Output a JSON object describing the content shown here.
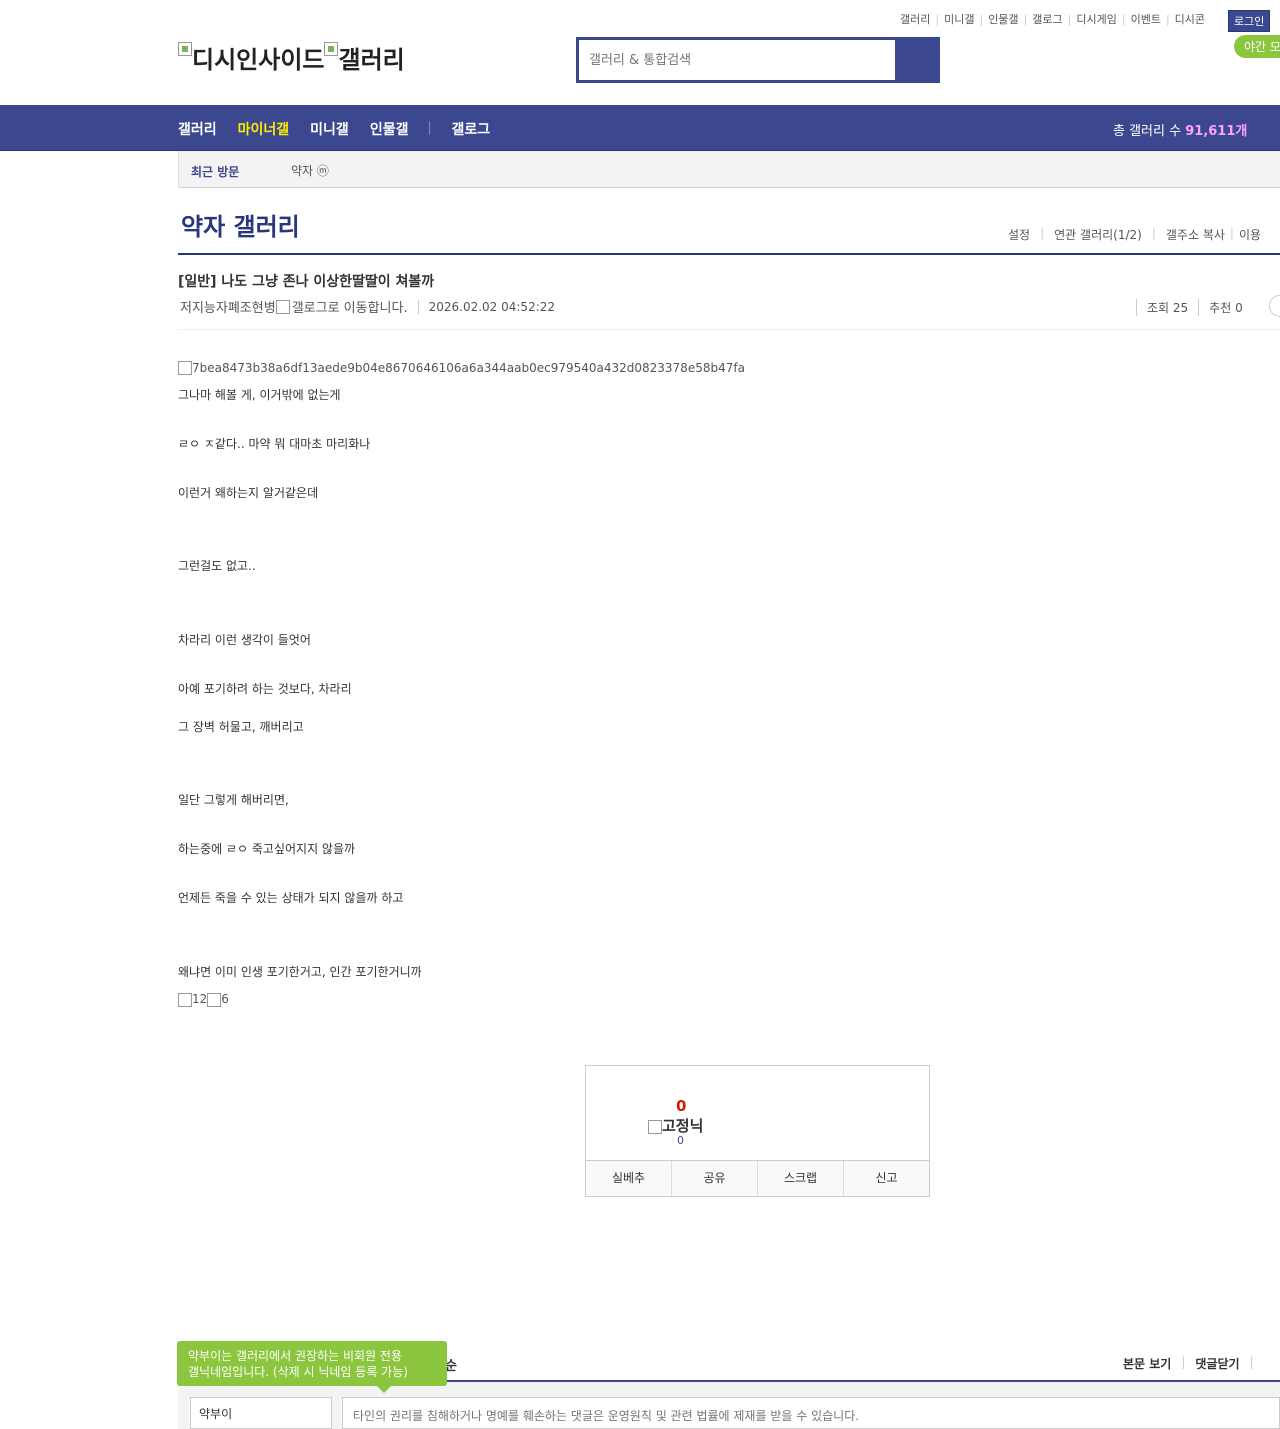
{
  "util_links": [
    "갤러리",
    "미니갤",
    "인물갤",
    "갤로그",
    "디시게임",
    "이벤트",
    "디시콘"
  ],
  "login_label": "로그인",
  "night_mode_label": "야간 모",
  "logo": {
    "left": "디시인사이드",
    "right": "갤러리"
  },
  "search": {
    "placeholder": "갤러리 & 통합검색"
  },
  "gnb": {
    "items": [
      "갤러리",
      "마이너갤",
      "미니갤",
      "인물갤"
    ],
    "gallog": "갤로그",
    "total_label": "총 갤러리 수",
    "total_count": "91,611개"
  },
  "recent": {
    "label": "최근 방문",
    "item": "약자 ⓜ"
  },
  "gallery": {
    "title": "약자 갤러리",
    "tools": [
      "설정",
      "연관 갤러리(1/2)",
      "갤주소 복사",
      "이용"
    ]
  },
  "post": {
    "title": "[일반] 나도 그냥 존나 이상한딸딸이 쳐볼까",
    "author": "저지능자폐조현병",
    "gallog_link": "갤로그로 이동합니다.",
    "date": "2026.02.02 04:52:22",
    "views": "조회 25",
    "recommend": "추천 0",
    "image_alt": "7bea8473b38a6df13aede9b04e8670646106a6a344aab0ec979540a432d0823378e58b47fa",
    "paragraphs": [
      "그나마 해볼 게, 이거밖에 없는게",
      "ㄹㅇ ㅈ같다.. 마약 뭐 대마초 마리화나",
      "이런거 왜하는지 알거같은데",
      "그런걸도 없고..",
      "차라리 이런 생각이 들엇어",
      "아예 포기하려 하는 것보다, 차라리",
      "그 장벽 허물고, 깨버리고",
      "일단 그렇게 해버리면,",
      "하는중에 ㄹㅇ 죽고싶어지지 않을까",
      "언제든 죽을 수 있는 상태가 되지 않을까 하고",
      "왜냐면 이미 인생 포기한거고, 인간 포기한거니까"
    ],
    "bottom_imgs": [
      "12",
      "6"
    ]
  },
  "recommend_box": {
    "count": "0",
    "fixed_nick_label": "고정닉",
    "fixed_count": "0",
    "buttons": [
      "실베추",
      "공유",
      "스크랩",
      "신고"
    ]
  },
  "comments": {
    "tooltip_line1": "약부이는 갤러리에서 권장하는 비회원 전용",
    "tooltip_line2": "갤닉네임입니다. (삭제 시 닉네임 등록 가능)",
    "header_tail": "순",
    "view_body": "본문 보기",
    "close_comments": "댓글닫기",
    "nick_value": "약부이",
    "placeholder": "타인의 권리를 침해하거나 명예를 훼손하는 댓글은 운영원칙 및 관련 법률에 제재를 받을 수 있습니다."
  }
}
